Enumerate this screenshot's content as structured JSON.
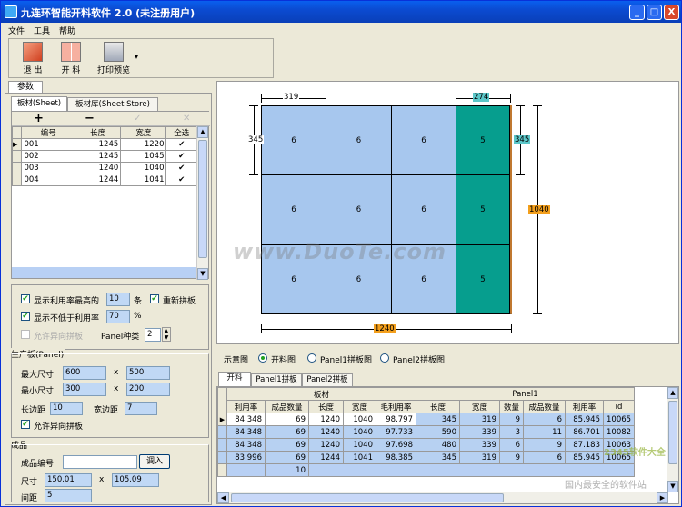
{
  "window": {
    "title": "九连环智能开料软件 2.0 (未注册用户)",
    "btn_min": "_",
    "btn_max": "□",
    "btn_close": "X"
  },
  "menu": [
    "文件",
    "工具",
    "帮助"
  ],
  "toolbar": {
    "exit": "退 出",
    "cut": "开 料",
    "print": "打印预览",
    "dropdown": "▾"
  },
  "left_tab": "参数",
  "sheet_tabs": [
    "板材(Sheet)",
    "板材库(Sheet Store)"
  ],
  "sheet_tools": {
    "add": "+",
    "remove": "−",
    "confirm": "✓",
    "cancel": "✕"
  },
  "sheet_table": {
    "headers": [
      "编号",
      "长度",
      "宽度",
      "全选"
    ],
    "rows": [
      {
        "id": "001",
        "length": "1245",
        "width": "1220",
        "check": "✔"
      },
      {
        "id": "002",
        "length": "1245",
        "width": "1045",
        "check": "✔"
      },
      {
        "id": "003",
        "length": "1240",
        "width": "1040",
        "check": "✔"
      },
      {
        "id": "004",
        "length": "1244",
        "width": "1041",
        "check": "✔"
      }
    ]
  },
  "options": {
    "show_top": "显示利用率最高的",
    "show_top_value": "10",
    "show_top_unit": "条",
    "recut": "重新拼板",
    "min_util": "显示不低于利用率",
    "min_util_value": "70",
    "min_util_unit": "%",
    "allow_rot_disabled": "允许异向拼板",
    "panel_kinds": "Panel种类",
    "panel_kinds_value": "2",
    "check": "✔"
  },
  "production": {
    "title": "生产板(Panel)",
    "max_size": "最大尺寸",
    "max_w": "600",
    "max_h": "500",
    "min_size": "最小尺寸",
    "min_w": "300",
    "min_h": "200",
    "times": "x",
    "long_margin": "长边距",
    "long_margin_value": "10",
    "wide_margin": "宽边距",
    "wide_margin_value": "7",
    "allow_rot": "允许异向拼板"
  },
  "product": {
    "title": "成品",
    "code": "成品编号",
    "code_value": "",
    "import": "调入",
    "size": "尺寸",
    "size_w": "150.01",
    "size_h": "105.09",
    "times": "x",
    "gap": "间距",
    "gap_value": "5"
  },
  "layout": {
    "sheet_length": "1240",
    "sheet_width": "1040",
    "piece_w_label": "319",
    "piece_h_label": "345",
    "piece_w2_label": "274",
    "piece_h2_label": "345",
    "pieces_a": [
      "6",
      "6",
      "6",
      "6",
      "6",
      "6",
      "6",
      "6",
      "6"
    ],
    "pieces_b": [
      "5",
      "5",
      "5"
    ],
    "colors": {
      "panel1": "#A7C7EE",
      "panel2": "#069E8E",
      "length_tag": "#F39F1C",
      "width_tag": "#F39F1C",
      "dim_tag": "#5CC7C9"
    }
  },
  "diagram": {
    "label": "示意图",
    "opts": [
      "开料图",
      "Panel1拼板图",
      "Panel2拼板图"
    ]
  },
  "result_tabs": [
    "开料",
    "Panel1拼板",
    "Panel2拼板"
  ],
  "result_table": {
    "group_sheet": "板材",
    "group_panel": "Panel1",
    "headers": [
      "利用率",
      "成品数量",
      "长度",
      "宽度",
      "毛利用率",
      "长度",
      "宽度",
      "数量",
      "成品数量",
      "利用率",
      "id"
    ],
    "rows": [
      [
        "84.348",
        "69",
        "1240",
        "1040",
        "98.797",
        "345",
        "319",
        "9",
        "6",
        "85.945",
        "10065"
      ],
      [
        "84.348",
        "69",
        "1240",
        "1040",
        "97.733",
        "590",
        "339",
        "3",
        "11",
        "86.701",
        "10082"
      ],
      [
        "84.348",
        "69",
        "1240",
        "1040",
        "97.698",
        "480",
        "339",
        "6",
        "9",
        "87.183",
        "10063"
      ],
      [
        "83.996",
        "69",
        "1244",
        "1041",
        "98.385",
        "345",
        "319",
        "9",
        "6",
        "85.945",
        "10065"
      ]
    ],
    "total": "10"
  },
  "watermark": {
    "main": "www.DuoTe.com",
    "sub": "国内最安全的软件站",
    "logo": "2345软件大全"
  }
}
